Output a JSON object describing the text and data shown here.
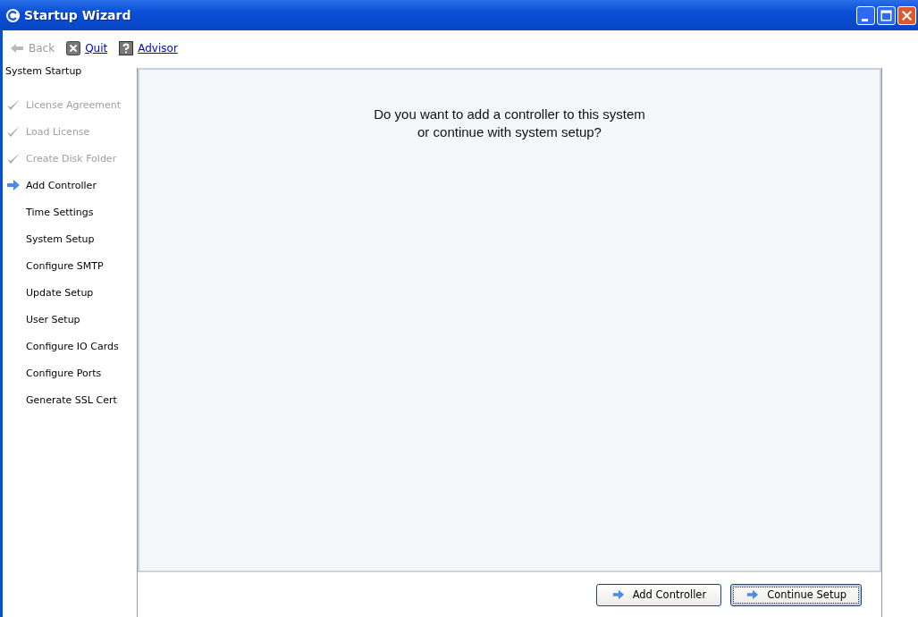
{
  "window": {
    "title": "Startup Wizard"
  },
  "toolbar": [
    {
      "kind": "back",
      "label": "Back",
      "disabled": true
    },
    {
      "kind": "quit",
      "label": "Quit",
      "disabled": false
    },
    {
      "kind": "advisor",
      "label": "Advisor",
      "disabled": false
    }
  ],
  "sidebar": {
    "heading": "System Startup",
    "steps": [
      {
        "label": "License Agreement",
        "done": true,
        "current": false
      },
      {
        "label": "Load License",
        "done": true,
        "current": false
      },
      {
        "label": "Create Disk Folder",
        "done": true,
        "current": false
      },
      {
        "label": "Add Controller",
        "done": false,
        "current": true
      },
      {
        "label": "Time Settings",
        "done": false,
        "current": false
      },
      {
        "label": "System Setup",
        "done": false,
        "current": false
      },
      {
        "label": "Configure SMTP",
        "done": false,
        "current": false
      },
      {
        "label": "Update Setup",
        "done": false,
        "current": false
      },
      {
        "label": "User Setup",
        "done": false,
        "current": false
      },
      {
        "label": "Configure IO Cards",
        "done": false,
        "current": false
      },
      {
        "label": "Configure Ports",
        "done": false,
        "current": false
      },
      {
        "label": "Generate SSL Cert",
        "done": false,
        "current": false
      }
    ]
  },
  "question": [
    "Do you want to add a controller to this system",
    "or continue with system setup?"
  ],
  "buttons": [
    {
      "label": "Add Controller",
      "focused": false
    },
    {
      "label": "Continue Setup",
      "focused": true
    }
  ]
}
